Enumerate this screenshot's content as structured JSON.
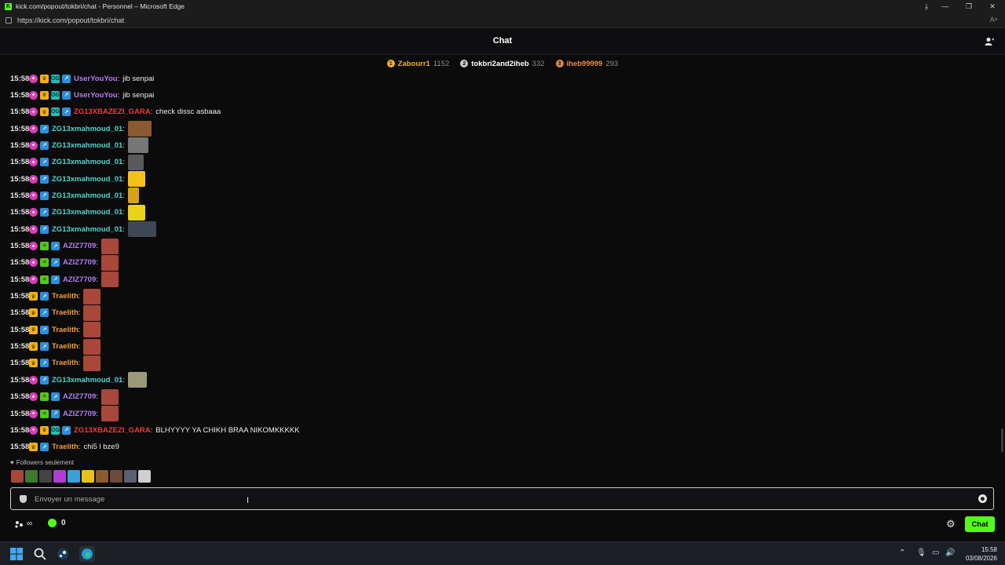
{
  "window": {
    "title": "kick.com/popout/tokbri/chat - Personnel – Microsoft Edge",
    "url": "https://kick.com/popout/tokbri/chat"
  },
  "chat": {
    "title": "Chat",
    "leaderboard": [
      {
        "rank": "1",
        "name": "Zabourr1",
        "count": "1152",
        "color": "#f3b10f",
        "name_color": "#f3b10f"
      },
      {
        "rank": "2",
        "name": "tokbri2and2iheb",
        "count": "332",
        "color": "#c9c9c9",
        "name_color": "#ffffff"
      },
      {
        "rank": "3",
        "name": "iheb99999",
        "count": "293",
        "color": "#e0894b",
        "name_color": "#f08a3e"
      }
    ],
    "messages": [
      {
        "time": "15:58",
        "badges": [
          "sub",
          "crown",
          "og",
          "verify"
        ],
        "user": "UserYouYou",
        "color": "#b57cf0",
        "text": "jib senpai"
      },
      {
        "time": "15:58",
        "badges": [
          "sub",
          "crown",
          "og",
          "verify"
        ],
        "user": "UserYouYou",
        "color": "#b57cf0",
        "text": "jib senpai"
      },
      {
        "time": "15:58",
        "badges": [
          "sub",
          "crown",
          "og",
          "verify"
        ],
        "user": "ZG13XBAZEZI_GARA",
        "color": "#ef3b3b",
        "text": "check dissc asbaaa"
      },
      {
        "time": "15:58",
        "badges": [
          "sub",
          "verify"
        ],
        "user": "ZG13xmahmoud_01",
        "color": "#4fd6d0",
        "text": "",
        "emote": "#8b5a2e",
        "emote_w": 30
      },
      {
        "time": "15:58",
        "badges": [
          "sub",
          "verify"
        ],
        "user": "ZG13xmahmoud_01",
        "color": "#4fd6d0",
        "text": "",
        "emote": "#777777",
        "emote_w": 26
      },
      {
        "time": "15:58",
        "badges": [
          "sub",
          "verify"
        ],
        "user": "ZG13xmahmoud_01",
        "color": "#4fd6d0",
        "text": "",
        "emote": "#5a5a5a",
        "emote_w": 20
      },
      {
        "time": "15:58",
        "badges": [
          "sub",
          "verify"
        ],
        "user": "ZG13xmahmoud_01",
        "color": "#4fd6d0",
        "text": "",
        "emote": "#f3c21a",
        "emote_w": 22
      },
      {
        "time": "15:58",
        "badges": [
          "sub",
          "verify"
        ],
        "user": "ZG13xmahmoud_01",
        "color": "#4fd6d0",
        "text": "",
        "emote": "#d9a11a",
        "emote_w": 14
      },
      {
        "time": "15:58",
        "badges": [
          "sub",
          "verify"
        ],
        "user": "ZG13xmahmoud_01",
        "color": "#4fd6d0",
        "text": "",
        "emote": "#e8d21a",
        "emote_w": 22
      },
      {
        "time": "15:58",
        "badges": [
          "sub",
          "verify"
        ],
        "user": "ZG13xmahmoud_01",
        "color": "#4fd6d0",
        "text": "",
        "emote": "#3f4654",
        "emote_w": 36
      },
      {
        "time": "15:58",
        "badges": [
          "sub",
          "green",
          "verify"
        ],
        "user": "AZIZ7709",
        "color": "#b57cf0",
        "text": "",
        "emote": "#a8473a",
        "emote_w": 22
      },
      {
        "time": "15:58",
        "badges": [
          "sub",
          "green",
          "verify"
        ],
        "user": "AZIZ7709",
        "color": "#b57cf0",
        "text": "",
        "emote": "#a8473a",
        "emote_w": 22
      },
      {
        "time": "15:58",
        "badges": [
          "sub",
          "green",
          "verify"
        ],
        "user": "AZIZ7709",
        "color": "#b57cf0",
        "text": "",
        "emote": "#a8473a",
        "emote_w": 22
      },
      {
        "time": "15:58",
        "badges": [
          "crown",
          "verify"
        ],
        "user": "Traelith",
        "color": "#f29c38",
        "text": "",
        "emote": "#a8473a",
        "emote_w": 22
      },
      {
        "time": "15:58",
        "badges": [
          "crown",
          "verify"
        ],
        "user": "Traelith",
        "color": "#f29c38",
        "text": "",
        "emote": "#a8473a",
        "emote_w": 22
      },
      {
        "time": "15:58",
        "badges": [
          "crown",
          "verify"
        ],
        "user": "Traelith",
        "color": "#f29c38",
        "text": "",
        "emote": "#a8473a",
        "emote_w": 22
      },
      {
        "time": "15:58",
        "badges": [
          "crown",
          "verify"
        ],
        "user": "Traelith",
        "color": "#f29c38",
        "text": "",
        "emote": "#a8473a",
        "emote_w": 22
      },
      {
        "time": "15:58",
        "badges": [
          "crown",
          "verify"
        ],
        "user": "Traelith",
        "color": "#f29c38",
        "text": "",
        "emote": "#a8473a",
        "emote_w": 22
      },
      {
        "time": "15:58",
        "badges": [
          "sub",
          "verify"
        ],
        "user": "ZG13xmahmoud_01",
        "color": "#4fd6d0",
        "text": "",
        "emote": "#9a9a7a",
        "emote_w": 24
      },
      {
        "time": "15:58",
        "badges": [
          "sub",
          "green",
          "verify"
        ],
        "user": "AZIZ7709",
        "color": "#b57cf0",
        "text": "",
        "emote": "#a8473a",
        "emote_w": 22
      },
      {
        "time": "15:58",
        "badges": [
          "sub",
          "green",
          "verify"
        ],
        "user": "AZIZ7709",
        "color": "#b57cf0",
        "text": "",
        "emote": "#a8473a",
        "emote_w": 22
      },
      {
        "time": "15:58",
        "badges": [
          "sub",
          "crown",
          "og",
          "verify"
        ],
        "user": "ZG13XBAZEZI_GARA",
        "color": "#ef3b3b",
        "text": "BLHYYYY YA CHIKH BRAA NIKOMKKKKK"
      },
      {
        "time": "15:58",
        "badges": [
          "crown",
          "verify"
        ],
        "user": "Traelith",
        "color": "#f29c38",
        "text": "chi5 l bze9"
      }
    ],
    "followers_only": "Followers seulement",
    "quick_emotes": [
      "#a8473a",
      "#3c7a2a",
      "#444444",
      "#b23bd8",
      "#3aa0d8",
      "#e8c21a",
      "#8b5a2e",
      "#6a4a3a",
      "#5a6070",
      "#cfcfcf"
    ],
    "input_placeholder": "Envoyer un message",
    "points_label": "∞",
    "coins": "0",
    "send_label": "Chat"
  },
  "taskbar": {
    "time": "15:58",
    "date": "03/08/2026"
  }
}
